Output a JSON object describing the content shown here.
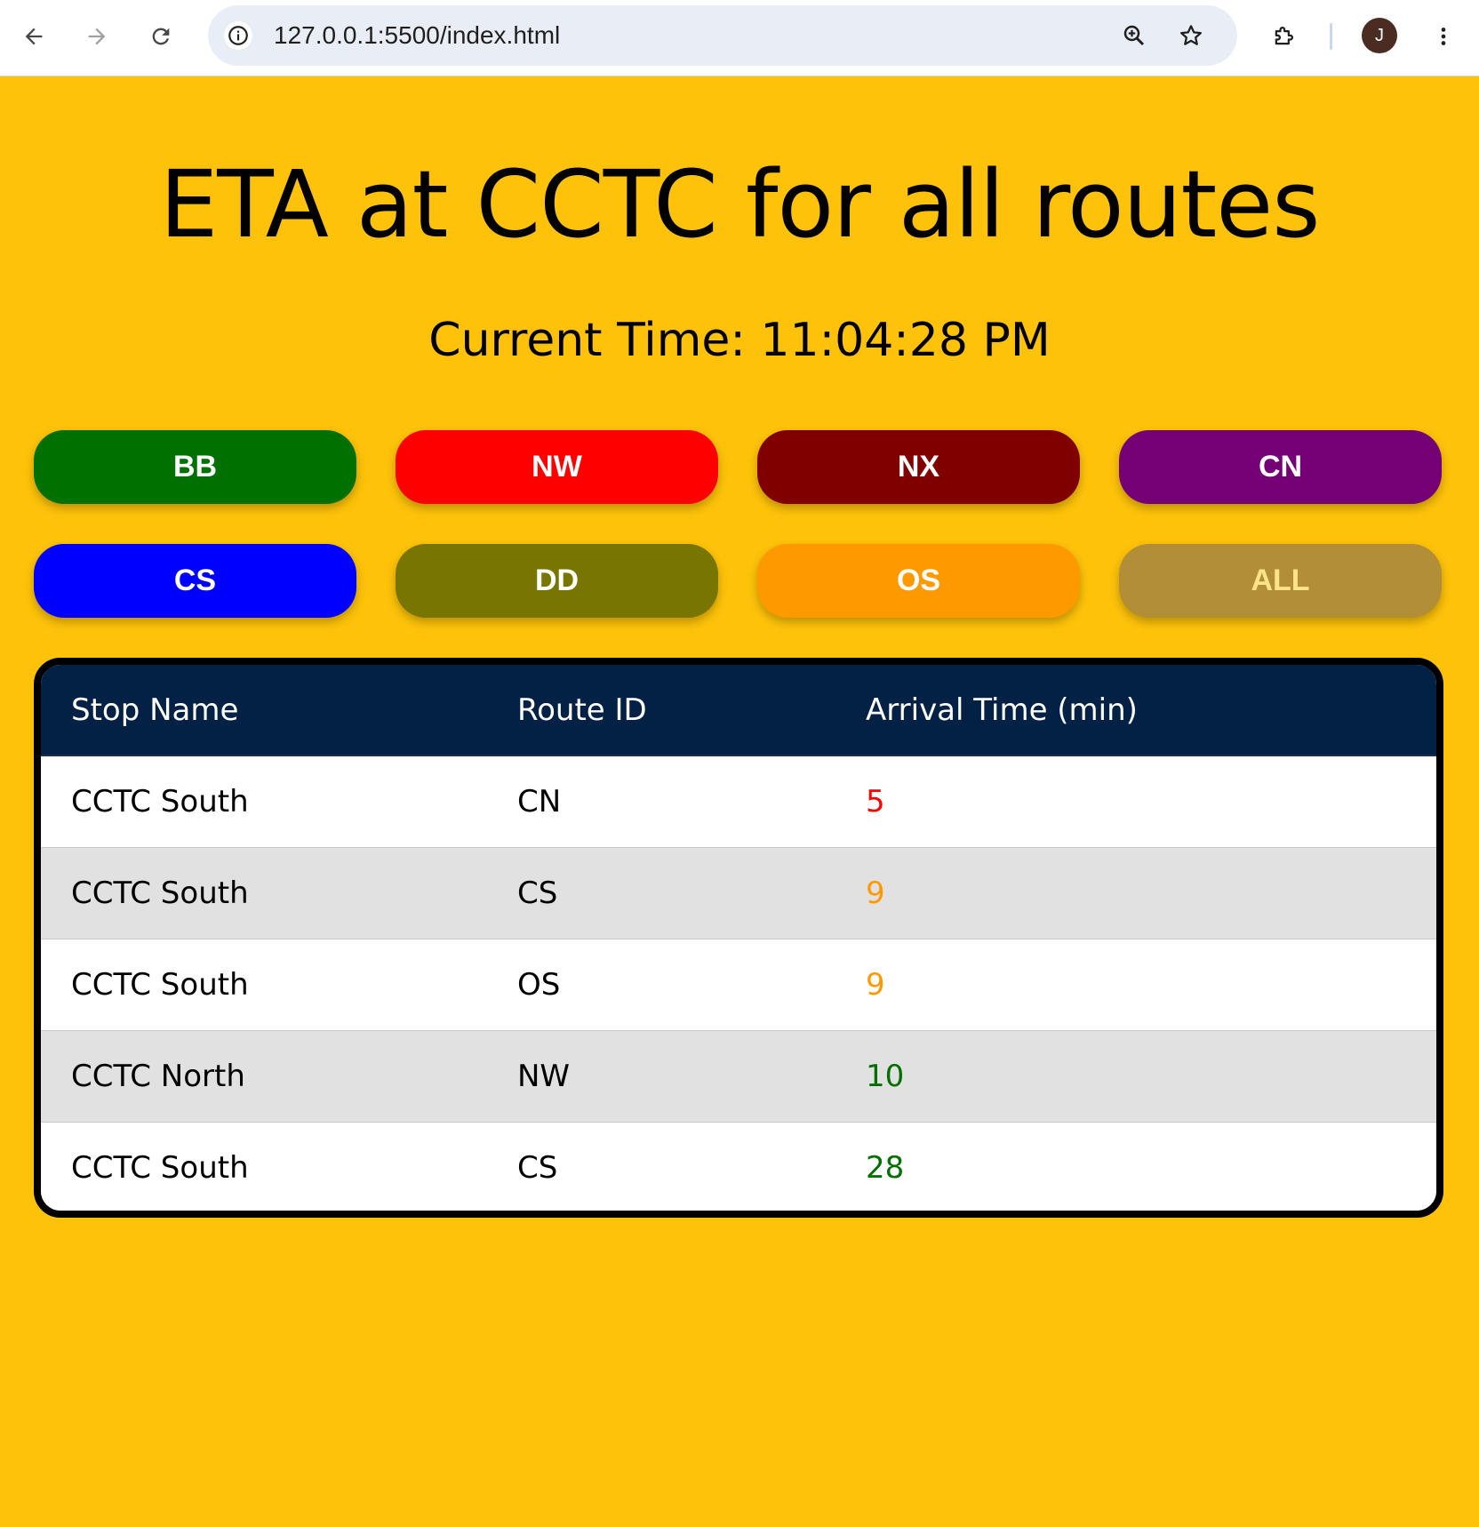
{
  "browser": {
    "url": "127.0.0.1:5500/index.html",
    "avatar_initial": "J"
  },
  "page": {
    "title": "ETA at CCTC for all routes",
    "time_label": "Current Time:",
    "time_value": "11:04:28 PM"
  },
  "routes": [
    {
      "label": "BB",
      "color": "#007000",
      "text_color": "#ffffff"
    },
    {
      "label": "NW",
      "color": "#ff0000",
      "text_color": "#ffffff"
    },
    {
      "label": "NX",
      "color": "#800000",
      "text_color": "#ffffff"
    },
    {
      "label": "CN",
      "color": "#750075",
      "text_color": "#ffffff"
    },
    {
      "label": "CS",
      "color": "#0000ff",
      "text_color": "#ffffff"
    },
    {
      "label": "DD",
      "color": "#787500",
      "text_color": "#ffffff"
    },
    {
      "label": "OS",
      "color": "#ff9900",
      "text_color": "#ffffff"
    },
    {
      "label": "ALL",
      "color": "#b28f37",
      "text_color": "#fde38a"
    }
  ],
  "table": {
    "headers": {
      "stop": "Stop Name",
      "route": "Route ID",
      "arrival": "Arrival Time (min)"
    },
    "rows": [
      {
        "stop": "CCTC South",
        "route": "CN",
        "arrival": "5",
        "arrival_color": "#ff0000"
      },
      {
        "stop": "CCTC South",
        "route": "CS",
        "arrival": "9",
        "arrival_color": "#ff9900"
      },
      {
        "stop": "CCTC South",
        "route": "OS",
        "arrival": "9",
        "arrival_color": "#ff9900"
      },
      {
        "stop": "CCTC North",
        "route": "NW",
        "arrival": "10",
        "arrival_color": "#007000"
      },
      {
        "stop": "CCTC South",
        "route": "CS",
        "arrival": "28",
        "arrival_color": "#007000"
      }
    ]
  },
  "colors": {
    "page_background": "#fdc209",
    "table_header": "#022144"
  }
}
